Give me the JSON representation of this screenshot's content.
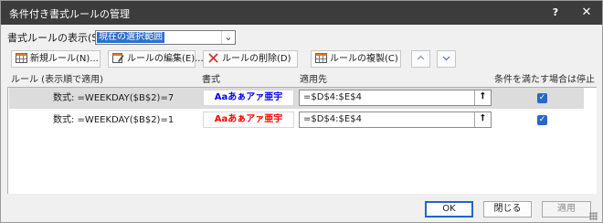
{
  "window": {
    "title": "条件付き書式ルールの管理",
    "help_label": "?",
    "close_label": "✕"
  },
  "scope": {
    "label": "書式ルールの表示(S):",
    "value": "現在の選択範囲",
    "dropdown_icon": "chevron-down-icon"
  },
  "toolbar": {
    "new_label": "新規ルール(N)...",
    "edit_label": "ルールの編集(E)...",
    "delete_label": "ルールの削除(D)",
    "copy_label": "ルールの複製(C)",
    "move_up_icon": "chevron-up-icon",
    "move_down_icon": "chevron-down-icon"
  },
  "list": {
    "headers": {
      "rule": "ルール (表示順で適用)",
      "format": "書式",
      "applies_to": "適用先",
      "stop_if_true": "条件を満たす場合は停止"
    },
    "rows": [
      {
        "rule": "数式: =WEEKDAY($B$2)=7",
        "preview": "Aaあぁアァ亜宇",
        "preview_color": "#0000ff",
        "applies_to": "=$D$4:$E$4",
        "stop_if_true": true,
        "selected": true
      },
      {
        "rule": "数式: =WEEKDAY($B$2)=1",
        "preview": "Aaあぁアァ亜宇",
        "preview_color": "#ff0000",
        "applies_to": "=$D$4:$E$4",
        "stop_if_true": true,
        "selected": false
      }
    ]
  },
  "buttons": {
    "ok_label": "OK",
    "close_label": "閉じる",
    "apply_label": "適用"
  },
  "colors": {
    "title_bar": "#3c3c3c",
    "selected_scope": "#2f6fd0",
    "checkbox": "#2868c8"
  }
}
